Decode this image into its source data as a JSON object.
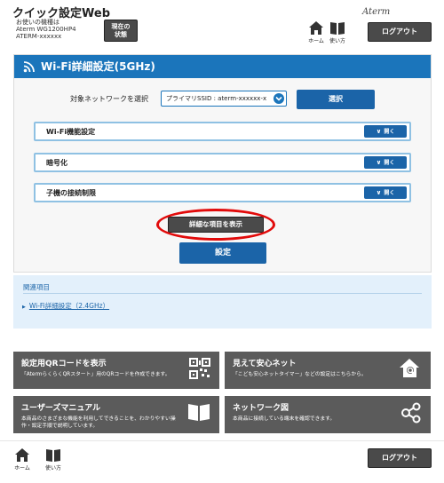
{
  "header": {
    "app_title": "クイック設定Web",
    "model_lines": [
      "お使いの機種は",
      "Aterm WG1200HP4",
      "ATERM-xxxxxx"
    ],
    "status_button": [
      "現在の",
      "状態"
    ],
    "home_label": "ホーム",
    "guide_label": "使い方",
    "brand": "Aterm",
    "logout_label": "ログアウト"
  },
  "section": {
    "title": "Wi-Fi詳細設定(5GHz)",
    "network_select_label": "対象ネットワークを選択",
    "ssid_value": "プライマリSSID : aterm-xxxxxx-x",
    "select_button": "選択",
    "accordions": [
      {
        "label": "Wi-Fi機能設定",
        "button": "開く"
      },
      {
        "label": "暗号化",
        "button": "開く"
      },
      {
        "label": "子機の接続制限",
        "button": "開く"
      }
    ],
    "detail_button": "詳細な項目を表示",
    "settings_button": "設定"
  },
  "related": {
    "title": "関連項目",
    "link": "Wi-Fi詳細設定（2.4GHz）"
  },
  "tiles": [
    {
      "title": "設定用QRコードを表示",
      "desc": "「AtermらくらくQRスタート」用のQRコードを作成できます。",
      "icon": "qr-code-icon"
    },
    {
      "title": "見えて安心ネット",
      "desc": "「こども安心ネットタイマー」などの設定はこちらから。",
      "icon": "house-search-icon"
    },
    {
      "title": "ユーザーズマニュアル",
      "desc": "本商品のさまざまな機能を利用してできることを、わかりやすい操作・設定手順で説明しています。",
      "icon": "book-icon"
    },
    {
      "title": "ネットワーク図",
      "desc": "本商品に接続している端末を確認できます。",
      "icon": "share-network-icon"
    }
  ],
  "footer": {
    "home_label": "ホーム",
    "guide_label": "使い方",
    "logout_label": "ログアウト"
  },
  "colors": {
    "primary_blue": "#1b75bb",
    "button_blue": "#1b64a8",
    "dark_gray": "#4a4a4a",
    "tile_gray": "#5b5b5b",
    "highlight_red": "#e20b0b",
    "related_bg": "#e3f0fb"
  }
}
